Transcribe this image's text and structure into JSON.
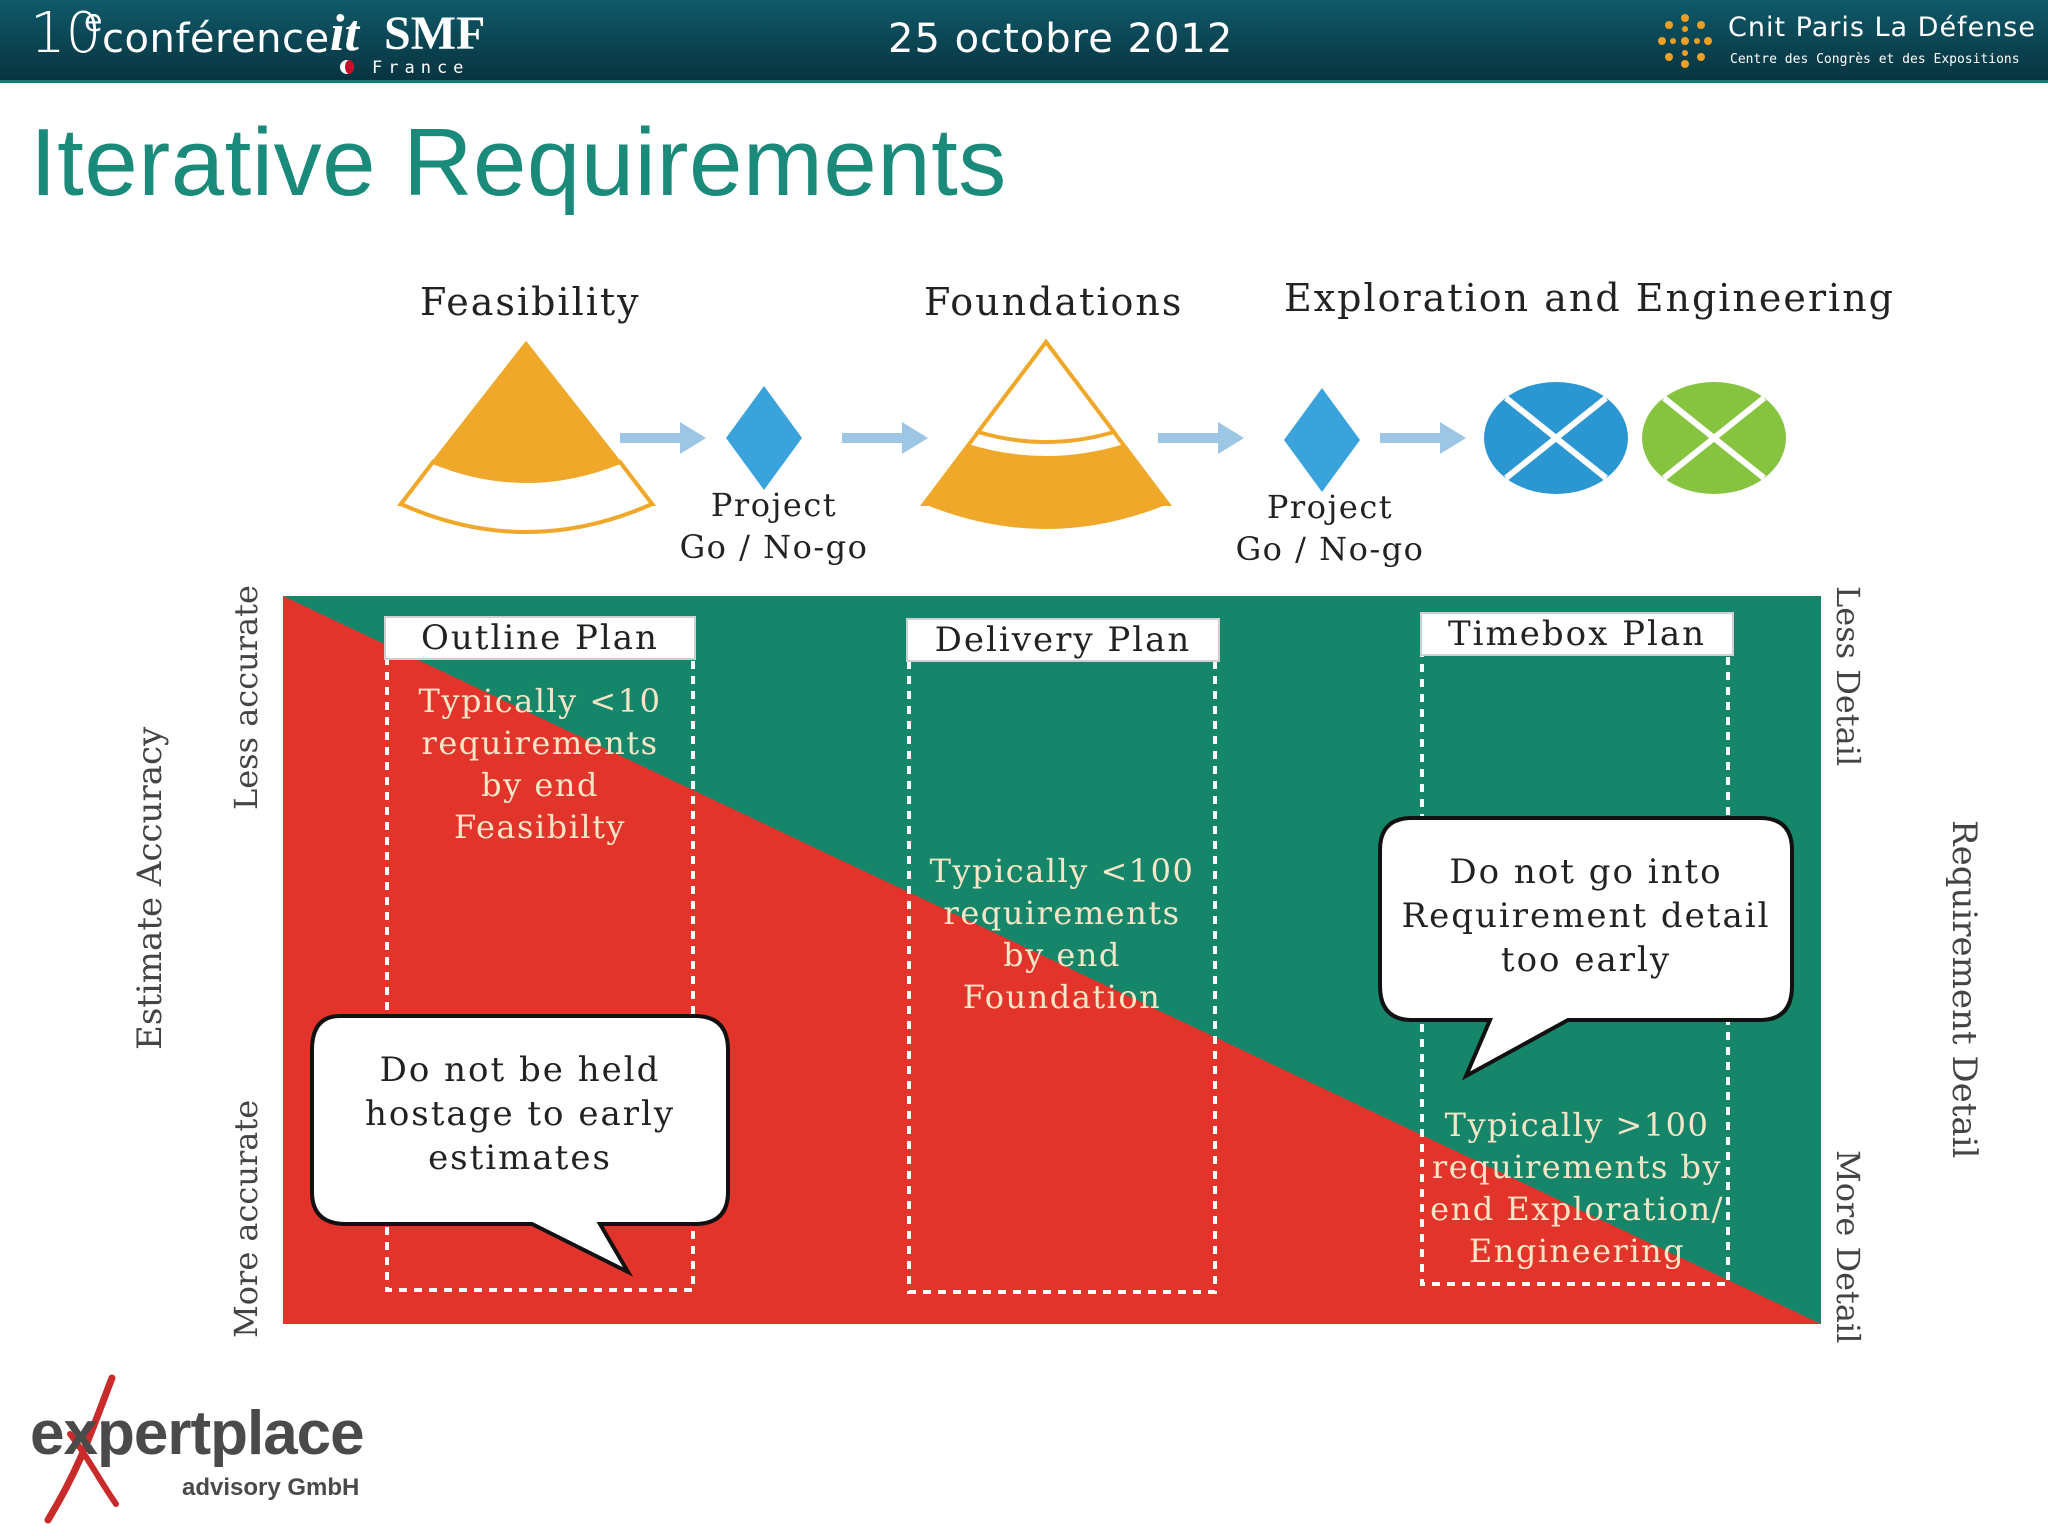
{
  "header": {
    "conference_number": "10",
    "conference_superscript": "e",
    "conference_word": "conférence",
    "org_it": "it",
    "org_smf": "SMF",
    "org_country": "France",
    "date": "25 octobre 2012",
    "venue_name": "Cnit Paris La Défense",
    "venue_subtitle": "Centre des Congrès et des Expositions"
  },
  "slide": {
    "title": "Iterative Requirements"
  },
  "diagram": {
    "phases": [
      "Feasibility",
      "Foundations",
      "Exploration and Engineering"
    ],
    "gates": [
      {
        "line1": "Project",
        "line2": "Go / No-go"
      },
      {
        "line1": "Project",
        "line2": "Go / No-go"
      }
    ],
    "plans": [
      {
        "title": "Outline Plan",
        "note": [
          "Typically <10",
          "requirements",
          "by end",
          "Feasibilty"
        ]
      },
      {
        "title": "Delivery Plan",
        "note": [
          "Typically <100",
          "requirements",
          "by end",
          "Foundation"
        ]
      },
      {
        "title": "Timebox Plan",
        "note": [
          "Typically >100",
          "requirements by",
          "end Exploration/",
          "Engineering"
        ]
      }
    ],
    "bubbles": [
      {
        "lines": [
          "Do not be held",
          "hostage to early",
          "estimates"
        ]
      },
      {
        "lines": [
          "Do not go into",
          "Requirement detail",
          "too early"
        ]
      }
    ],
    "axis": {
      "estimate_accuracy": "Estimate Accuracy",
      "less_accurate": "Less accurate",
      "more_accurate": "More accurate",
      "requirement_detail": "Requirement Detail",
      "less_detail": "Less Detail",
      "more_detail": "More Detail"
    },
    "colors": {
      "accent_orange": "#f0a82a",
      "diamond_blue": "#3aa3dc",
      "circle_blue": "#2b97d2",
      "circle_green": "#86c440",
      "arrow_blue": "#9cc6e4",
      "area_green": "#16866a",
      "area_red": "#e3342b"
    }
  },
  "company": {
    "logo_text": "expertplace",
    "logo_subtitle": "advisory GmbH"
  }
}
